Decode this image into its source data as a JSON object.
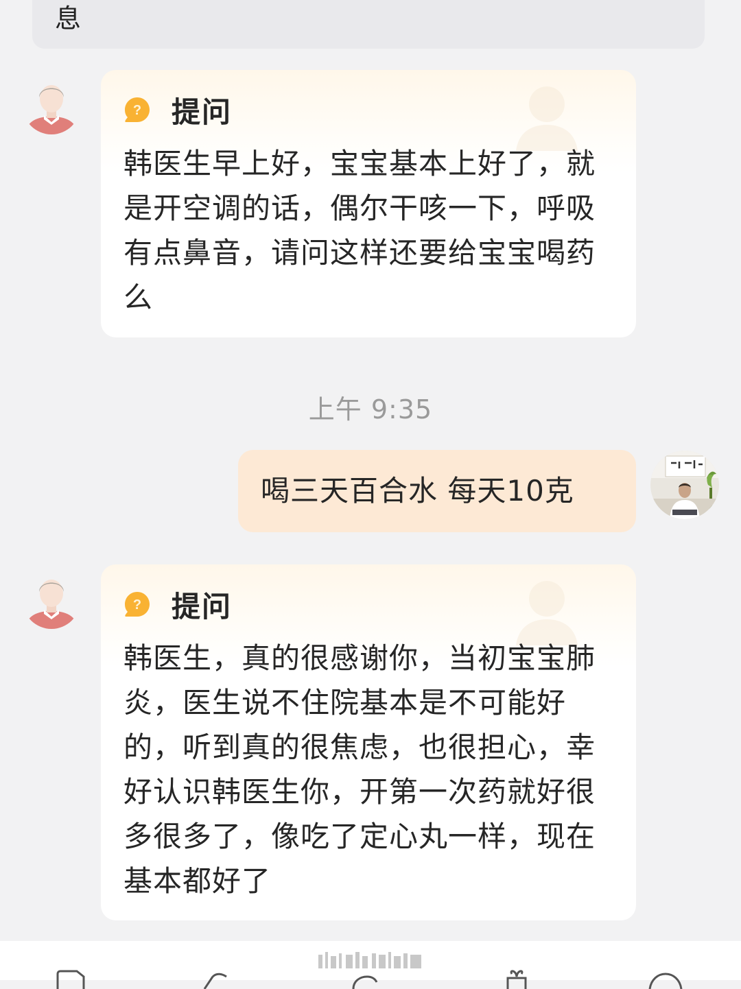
{
  "top_message": {
    "text_tail": "息"
  },
  "messages": [
    {
      "label": "提问",
      "text": "韩医生早上好，宝宝基本上好了，就是开空调的话，偶尔干咳一下，呼吸有点鼻音，请问这样还要给宝宝喝药么"
    },
    {
      "label": "提问",
      "text": "韩医生，真的很感谢你，当初宝宝肺炎，医生说不住院基本是不可能好的，听到真的很焦虑，也很担心，幸好认识韩医生你，开第一次药就好很多很多了，像吃了定心丸一样，现在基本都好了"
    }
  ],
  "timestamp": "上午 9:35",
  "reply": {
    "text": "喝三天百合水 每天10克"
  },
  "colors": {
    "background": "#f2f2f3",
    "question_icon": "#f9b233",
    "reply_bubble": "#fde9d5"
  }
}
